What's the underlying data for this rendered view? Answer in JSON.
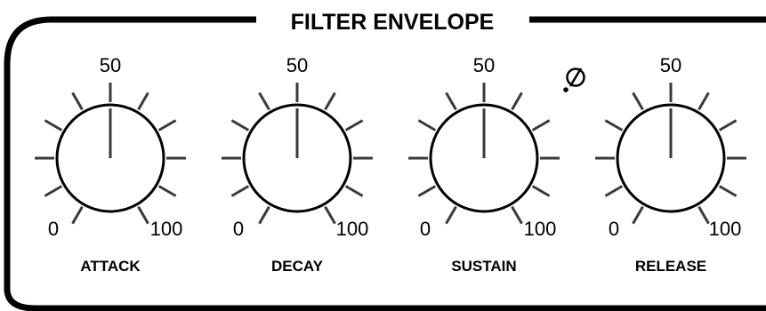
{
  "panel": {
    "title": "FILTER ENVELOPE"
  },
  "knobs": [
    {
      "label": "ATTACK",
      "min_label": "0",
      "mid_label": "50",
      "max_label": "100",
      "value": 50
    },
    {
      "label": "DECAY",
      "min_label": "0",
      "mid_label": "50",
      "max_label": "100",
      "value": 50
    },
    {
      "label": "SUSTAIN",
      "min_label": "0",
      "mid_label": "50",
      "max_label": "100",
      "value": 50
    },
    {
      "label": "RELEASE",
      "min_label": "0",
      "mid_label": "50",
      "max_label": "100",
      "value": 50
    }
  ],
  "icons": {
    "trimmer": "trimmer-screw-icon"
  },
  "colors": {
    "background": "#ffffff",
    "ink": "#000000",
    "tick": "#3a3a3a"
  }
}
